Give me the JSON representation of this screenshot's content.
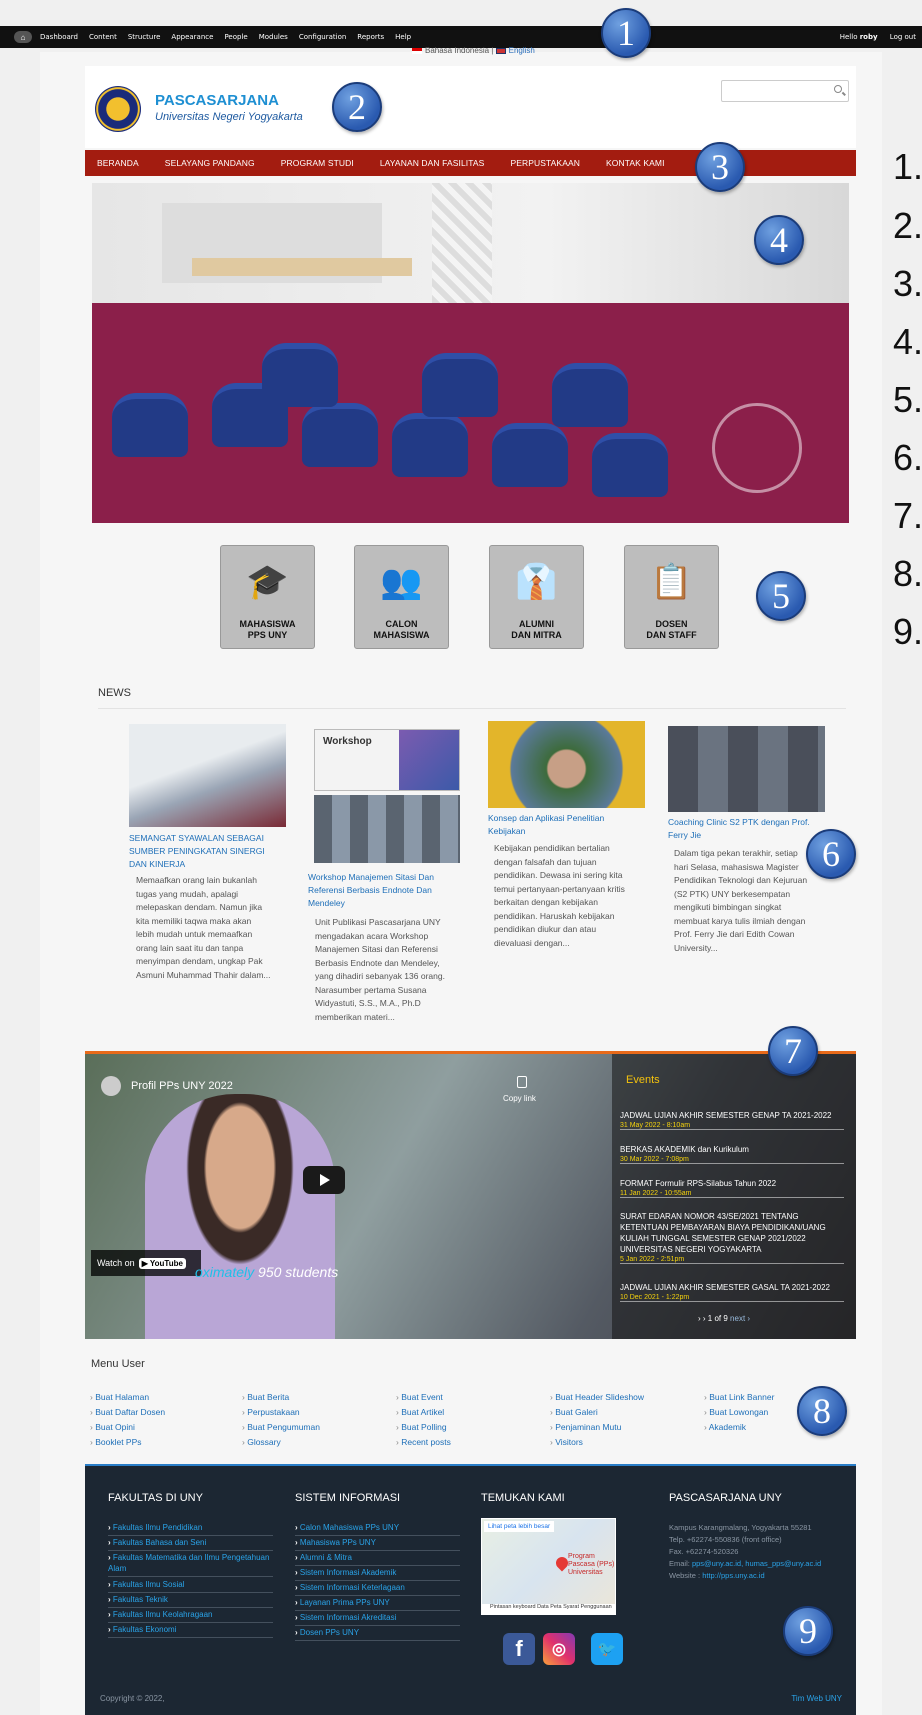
{
  "admin": {
    "items": [
      "Dashboard",
      "Content",
      "Structure",
      "Appearance",
      "People",
      "Modules",
      "Configuration",
      "Reports",
      "Help"
    ],
    "hello": "Hello",
    "user": "roby",
    "logout": "Log out"
  },
  "lang": {
    "id": "Bahasa Indonesia",
    "sep": "|",
    "en": "English"
  },
  "brand": {
    "title": "PASCASARJANA",
    "subtitle": "Universitas Negeri Yogyakarta"
  },
  "nav": [
    "BERANDA",
    "SELAYANG PANDANG",
    "PROGRAM STUDI",
    "LAYANAN DAN FASILITAS",
    "PERPUSTAKAAN",
    "KONTAK KAMI"
  ],
  "tiles": [
    {
      "label": "MAHASISWA\nPPS UNY",
      "icon": "graduation-cap-icon",
      "glyph": "🎓"
    },
    {
      "label": "CALON\nMAHASISWA",
      "icon": "group-icon",
      "glyph": "👥"
    },
    {
      "label": "ALUMNI\nDAN MITRA",
      "icon": "person-tie-icon",
      "glyph": "👔"
    },
    {
      "label": "DOSEN\nDAN STAFF",
      "icon": "teacher-board-icon",
      "glyph": "📋"
    }
  ],
  "news": {
    "title": "NEWS",
    "items": [
      {
        "title": "SEMANGAT SYAWALAN SEBAGAI SUMBER PENINGKATAN SINERGI DAN KINERJA",
        "body": "Memaafkan orang lain bukanlah tugas yang mudah, apalagi melepaskan dendam. Namun jika kita memiliki taqwa maka akan lebih mudah untuk memaafkan orang lain saat itu dan tanpa menyimpan dendam, ungkap Pak Asmuni Muhammad Thahir dalam..."
      },
      {
        "title": "Workshop Manajemen Sitasi Dan Referensi Berbasis Endnote Dan Mendeley",
        "body": "Unit Publikasi Pascasarjana UNY mengadakan acara Workshop Manajemen Sitasi dan Referensi Berbasis Endnote dan Mendeley, yang dihadiri sebanyak 136 orang. Narasumber pertama Susana Widyastuti, S.S., M.A., Ph.D memberikan materi...",
        "image_text": "Workshop"
      },
      {
        "title": "Konsep dan Aplikasi Penelitian Kebijakan",
        "body": "Kebijakan pendidikan bertalian dengan falsafah dan tujuan pendidikan. Dewasa ini sering kita temui pertanyaan-pertanyaan kritis berkaitan dengan kebijakan pendidikan. Haruskah kebijakan pendidikan diukur dan atau dievaluasi dengan..."
      },
      {
        "title": "Coaching Clinic S2 PTK dengan Prof. Ferry Jie",
        "body": "Dalam tiga pekan terakhir, setiap hari Selasa, mahasiswa Magister Pendidikan Teknologi dan Kejuruan (S2 PTK) UNY berkesempatan mengikuti bimbingan singkat membuat karya tulis ilmiah dengan Prof. Ferry Jie dari Edith Cowan University..."
      }
    ]
  },
  "video": {
    "title": "Profil PPs UNY 2022",
    "copy_link": "Copy link",
    "watch_on": "Watch on",
    "youtube": "▶ YouTube",
    "caption_accent": "oximately",
    "caption": "950 students"
  },
  "events": {
    "title": "Events",
    "items": [
      {
        "title": "JADWAL UJIAN AKHIR SEMESTER GENAP TA 2021-2022",
        "date": "31 May 2022 - 8:10am"
      },
      {
        "title": "BERKAS AKADEMIK dan Kurikulum",
        "date": "30 Mar 2022 - 7:08pm"
      },
      {
        "title": "FORMAT Formulir RPS-Silabus Tahun 2022",
        "date": "11 Jan 2022 - 10:55am"
      },
      {
        "title": "SURAT EDARAN NOMOR 43/SE/2021 TENTANG KETENTUAN PEMBAYARAN BIAYA PENDIDIKAN/UANG KULIAH TUNGGAL SEMESTER GENAP 2021/2022 UNIVERSITAS NEGERI YOGYAKARTA",
        "date": "5 Jan 2022 - 2:51pm"
      },
      {
        "title": "JADWAL UJIAN AKHIR SEMESTER GASAL TA 2021-2022",
        "date": "10 Dec 2021 - 1:22pm"
      }
    ],
    "pager": "1 of 9",
    "next": "next ›"
  },
  "menu_user": {
    "title": "Menu User",
    "columns": [
      [
        "Buat Halaman",
        "Buat Daftar Dosen",
        "Buat Opini",
        "Booklet PPs"
      ],
      [
        "Buat Berita",
        "Perpustakaan",
        "Buat Pengumuman",
        "Glossary"
      ],
      [
        "Buat Event",
        "Buat Artikel",
        "Buat Polling",
        "Recent posts"
      ],
      [
        "Buat Header Slideshow",
        "Buat Galeri",
        "Penjaminan Mutu",
        "Visitors"
      ],
      [
        "Buat Link Banner",
        "Buat Lowongan",
        "Akademik"
      ]
    ]
  },
  "footer": {
    "fakultas": {
      "title": "FAKULTAS DI UNY",
      "links": [
        "Fakultas Ilmu Pendidikan",
        "Fakultas Bahasa dan Seni",
        "Fakultas Matematika dan Ilmu Pengetahuan Alam",
        "Fakultas Ilmu Sosial",
        "Fakultas Teknik",
        "Fakultas Ilmu Keolahragaan",
        "Fakultas Ekonomi"
      ]
    },
    "sistem": {
      "title": "SISTEM INFORMASI",
      "links": [
        "Calon Mahasiswa PPs UNY",
        "Mahasiswa PPs UNY",
        "Alumni & Mitra",
        "Sistem Informasi Akademik",
        "Sistem Informasi Keterlagaan",
        "Layanan Prima PPs UNY",
        "Sistem Informasi Akreditasi",
        "Dosen PPs UNY"
      ]
    },
    "temukan": {
      "title": "TEMUKAN KAMI",
      "map_link": "Lihat peta lebih besar",
      "map_pin_label": "Program Pascasa (PPs) Universitas",
      "map_footer": "Pintasan keyboard   Data Peta   Syarat Penggunaan"
    },
    "pps": {
      "title": "PASCASARJANA UNY",
      "address": "Kampus Karangmalang, Yogyakarta 55281",
      "telp": "Telp. +62274-550836 (front office)",
      "fax": "Fax. +62274-520326",
      "email_label": "Email:",
      "email": "pps@uny.ac.id, humas_pps@uny.ac.id",
      "website_label": "Website :",
      "website": "http://pps.uny.ac.id"
    },
    "copyright": "Copyright © 2022,",
    "credit": "Tim Web UNY"
  },
  "badges": [
    "1",
    "2",
    "3",
    "4",
    "5",
    "6",
    "7",
    "8",
    "9"
  ],
  "legend": [
    "1.",
    "2.",
    "3.",
    "4.",
    "5.",
    "6.",
    "7.",
    "8.",
    "9."
  ],
  "colors": {
    "nav": "#a31c10",
    "brand": "#1e8fd2",
    "footer": "#1c2733",
    "accent_orange": "#e86a1a",
    "badge": "#2a5ab0"
  }
}
